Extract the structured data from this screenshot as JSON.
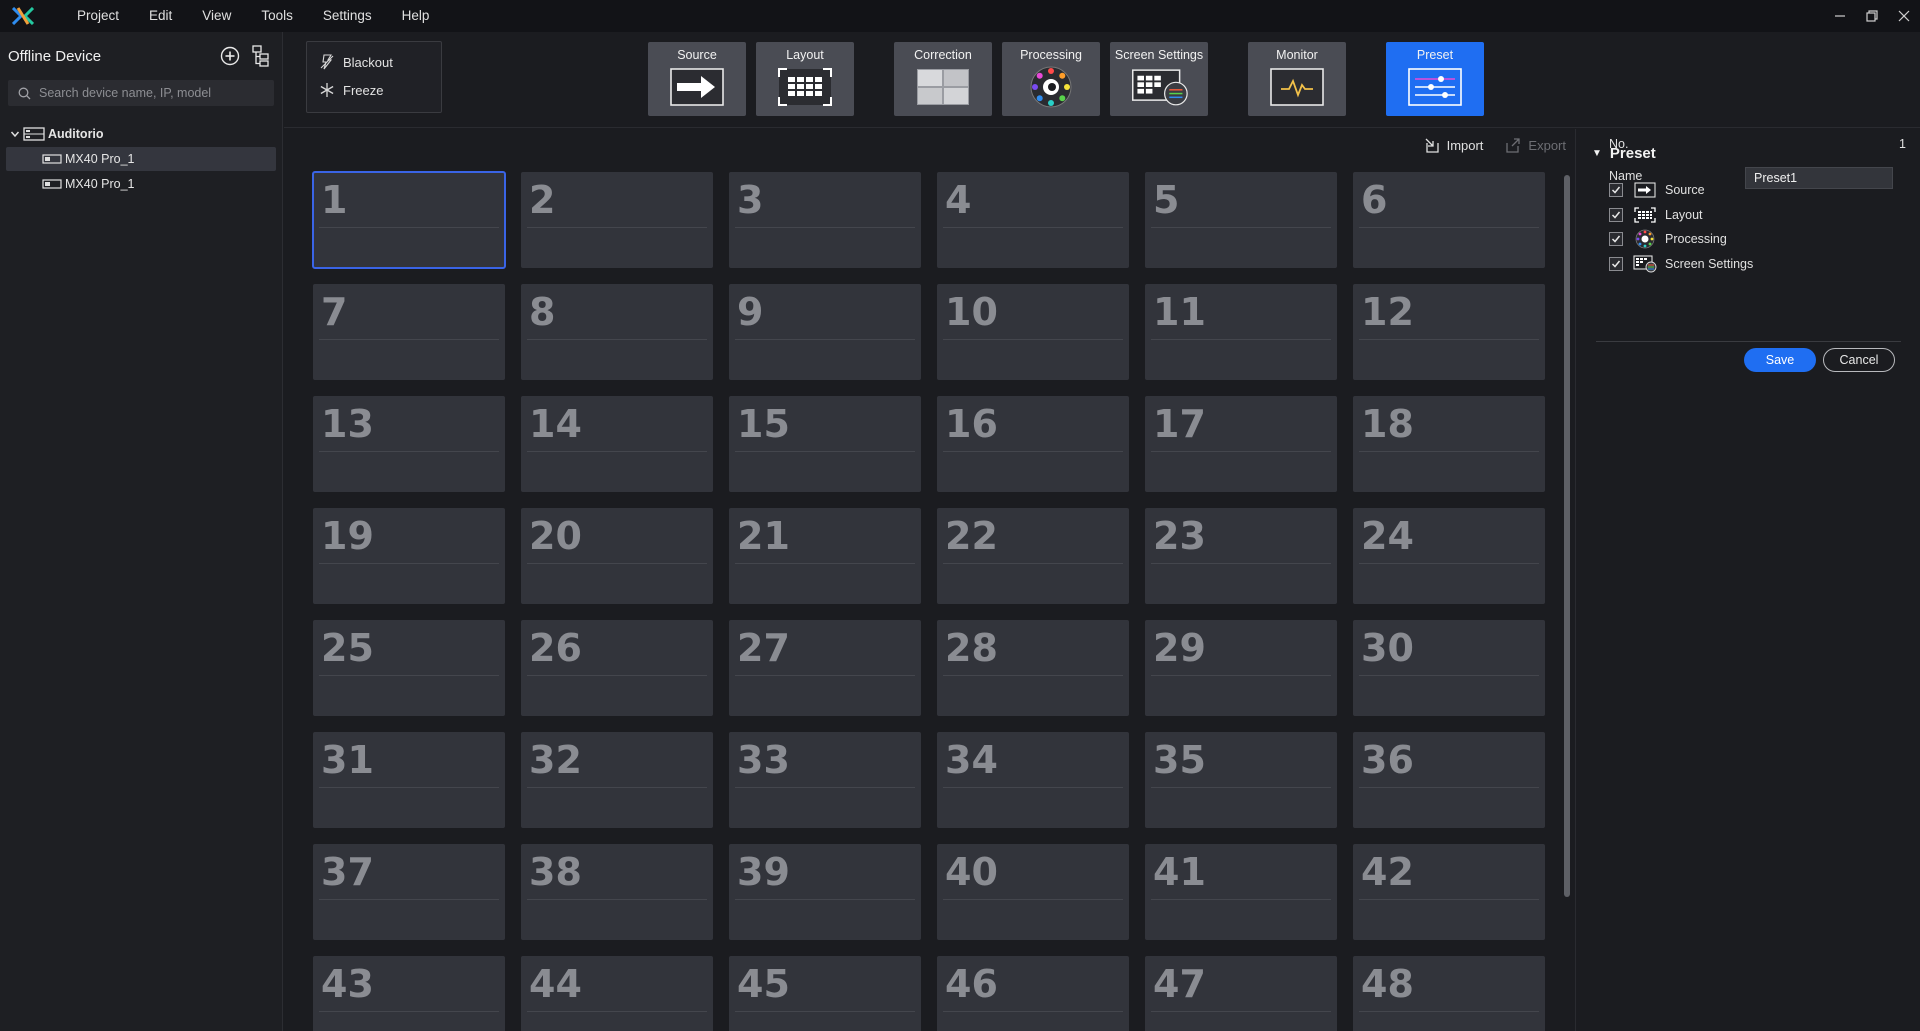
{
  "menu": [
    "Project",
    "Edit",
    "View",
    "Tools",
    "Settings",
    "Help"
  ],
  "device_panel": {
    "title": "Offline Device",
    "search_placeholder": "Search device name, IP, model",
    "tree": {
      "group": "Auditorio",
      "devices": [
        "MX40 Pro_1",
        "MX40 Pro_1"
      ]
    }
  },
  "quick_actions": {
    "blackout": "Blackout",
    "freeze": "Freeze"
  },
  "tools": {
    "source": "Source",
    "layout": "Layout",
    "correction": "Correction",
    "processing": "Processing",
    "screen_settings": "Screen Settings",
    "monitor": "Monitor",
    "preset": "Preset",
    "active": "Preset"
  },
  "content": {
    "import_label": "Import",
    "export_label": "Export",
    "preset_slots": [
      "1",
      "2",
      "3",
      "4",
      "5",
      "6",
      "7",
      "8",
      "9",
      "10",
      "11",
      "12",
      "13",
      "14",
      "15",
      "16",
      "17",
      "18",
      "19",
      "20",
      "21",
      "22",
      "23",
      "24",
      "25",
      "26",
      "27",
      "28",
      "29",
      "30",
      "31",
      "32",
      "33",
      "34",
      "35",
      "36",
      "37",
      "38",
      "39",
      "40",
      "41",
      "42",
      "43",
      "44",
      "45",
      "46",
      "47",
      "48"
    ],
    "selected_slot": "1"
  },
  "preset_panel": {
    "title": "Preset",
    "no_label": "No.",
    "no_value": "1",
    "name_label": "Name",
    "name_value": "Preset1",
    "options": [
      {
        "label": "Source",
        "checked": true,
        "icon": "source-icon"
      },
      {
        "label": "Layout",
        "checked": true,
        "icon": "layout-icon"
      },
      {
        "label": "Processing",
        "checked": true,
        "icon": "processing-icon"
      },
      {
        "label": "Screen Settings",
        "checked": true,
        "icon": "screen-settings-icon"
      }
    ],
    "save_label": "Save",
    "cancel_label": "Cancel"
  },
  "colors": {
    "accent": "#1f6ef2",
    "background": "#1b1c20",
    "tile": "#32343b",
    "tool_button": "#4a4c54"
  }
}
